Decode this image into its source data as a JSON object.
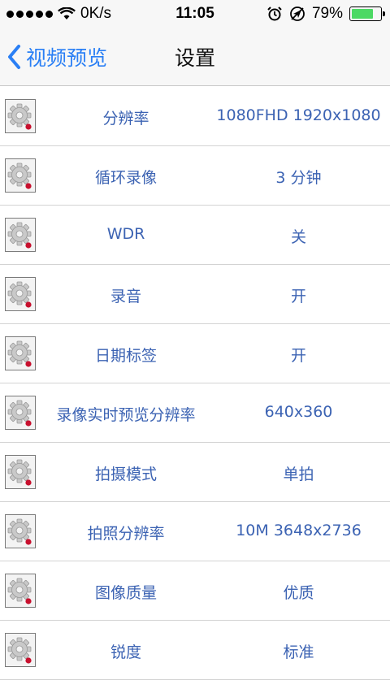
{
  "status_bar": {
    "speed": "0K/s",
    "time": "11:05",
    "battery": "79%",
    "battery_level": 0.79,
    "icons": [
      "signal-dots-icon",
      "wifi-icon",
      "alarm-icon",
      "location-icon",
      "battery-icon"
    ]
  },
  "nav": {
    "back_label": "视频预览",
    "title": "设置"
  },
  "colors": {
    "accent": "#2a7ff5",
    "item_text": "#3c63b3",
    "battery_green": "#4cd964"
  },
  "settings": [
    {
      "label": "分辨率",
      "value": "1080FHD 1920x1080"
    },
    {
      "label": "循环录像",
      "value": "3 分钟"
    },
    {
      "label": "WDR",
      "value": "关"
    },
    {
      "label": "录音",
      "value": "开"
    },
    {
      "label": "日期标签",
      "value": "开"
    },
    {
      "label": "录像实时预览分辨率",
      "value": "640x360"
    },
    {
      "label": "拍摄模式",
      "value": "单拍"
    },
    {
      "label": "拍照分辨率",
      "value": "10M 3648x2736"
    },
    {
      "label": "图像质量",
      "value": "优质"
    },
    {
      "label": "锐度",
      "value": "标准"
    }
  ]
}
